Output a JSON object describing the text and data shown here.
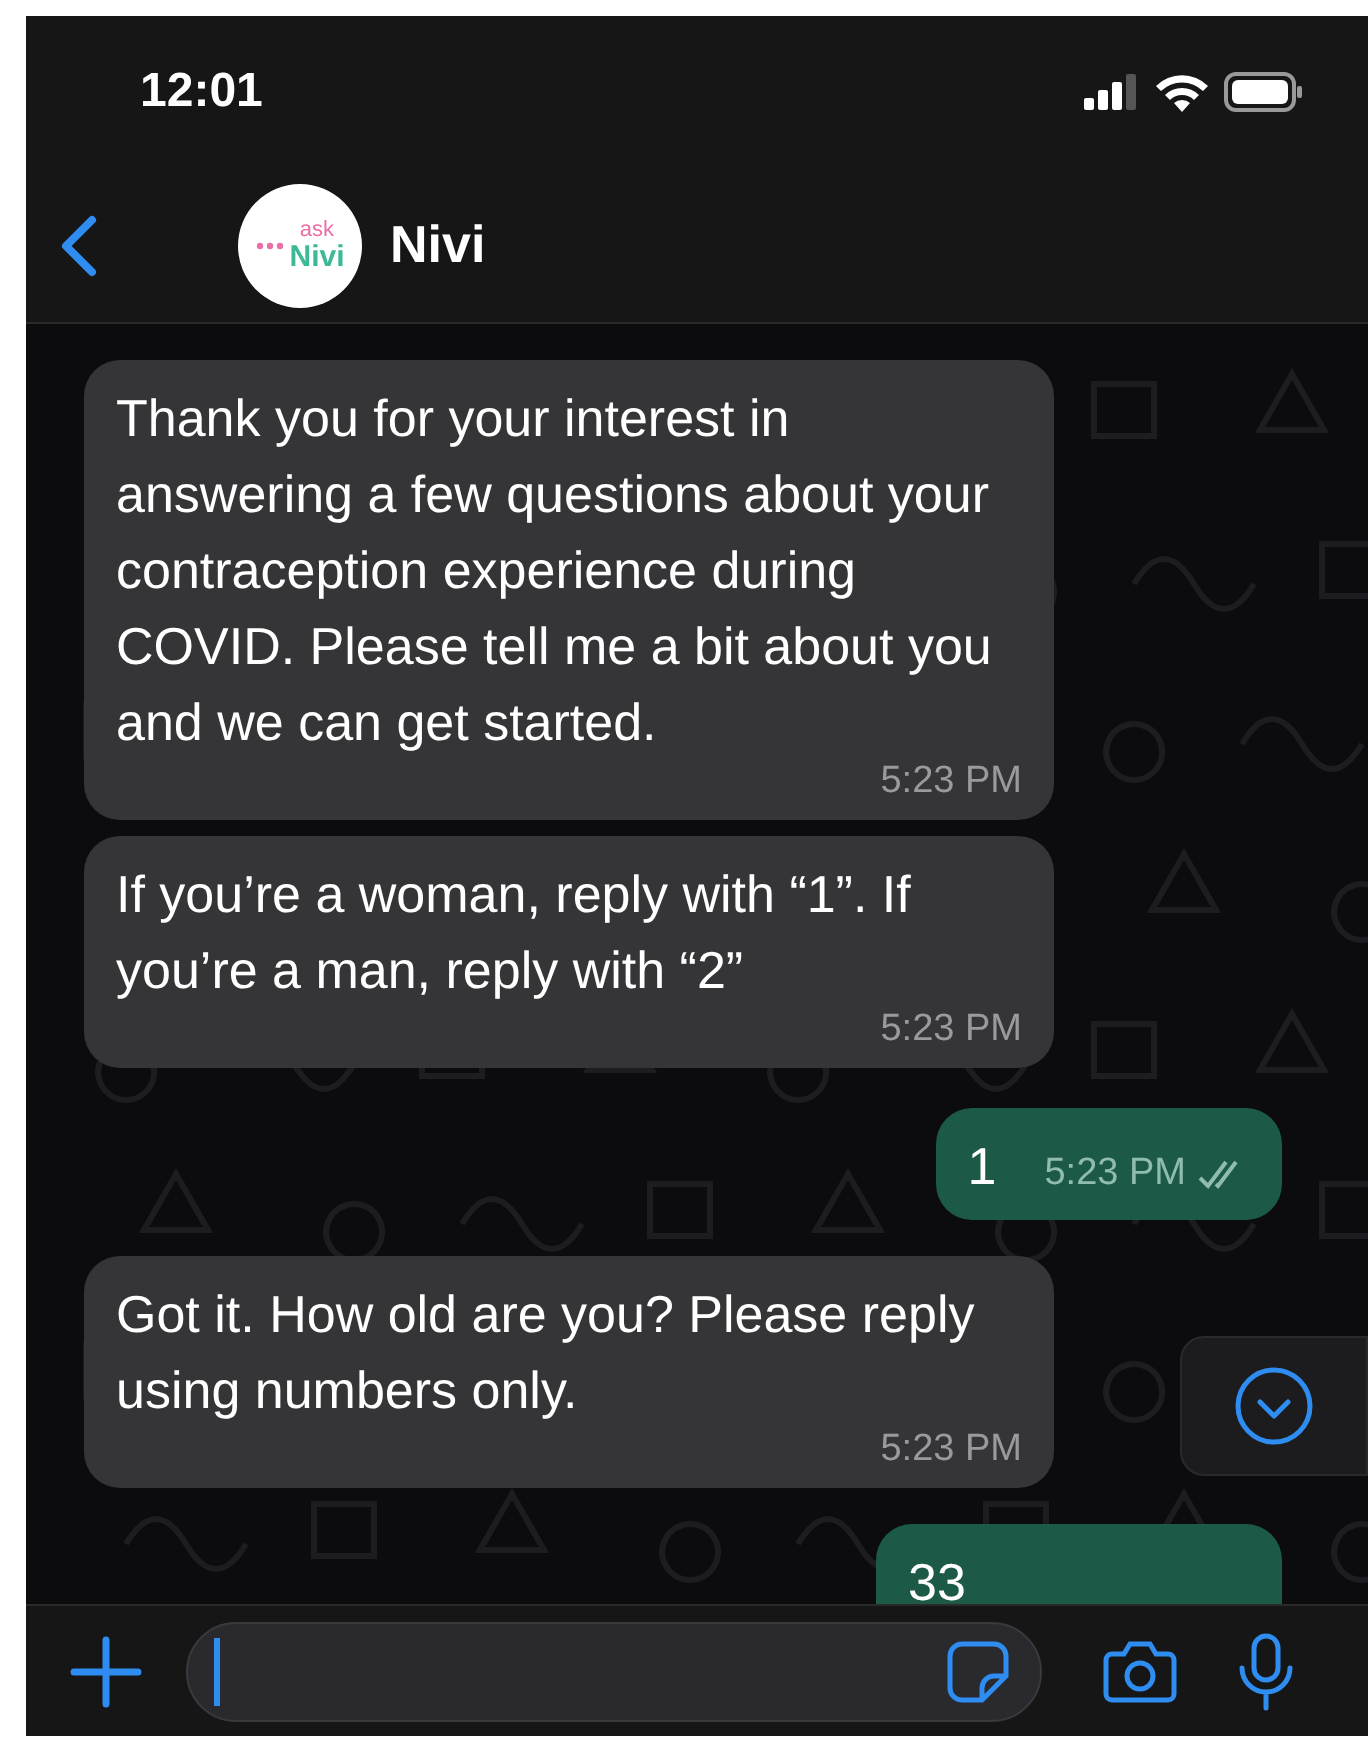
{
  "status_bar": {
    "time": "12:01"
  },
  "header": {
    "avatar": {
      "top": "ask",
      "bottom": "Nivi"
    },
    "name": "Nivi"
  },
  "messages": [
    {
      "kind": "incoming",
      "text": "Thank you for your interest in answering a few questions about your contraception experience during COVID. Please tell me a bit about you and we can get started.",
      "time": "5:23 PM"
    },
    {
      "kind": "incoming",
      "text": "If you’re a woman, reply with “1”. If you’re a man, reply with “2”",
      "time": "5:23 PM"
    },
    {
      "kind": "outgoing",
      "text": "1",
      "time": "5:23 PM",
      "read": true
    },
    {
      "kind": "incoming",
      "text": "Got it. How old are you? Please reply using numbers only.",
      "time": "5:23 PM"
    },
    {
      "kind": "outgoing",
      "text": "33"
    }
  ]
}
